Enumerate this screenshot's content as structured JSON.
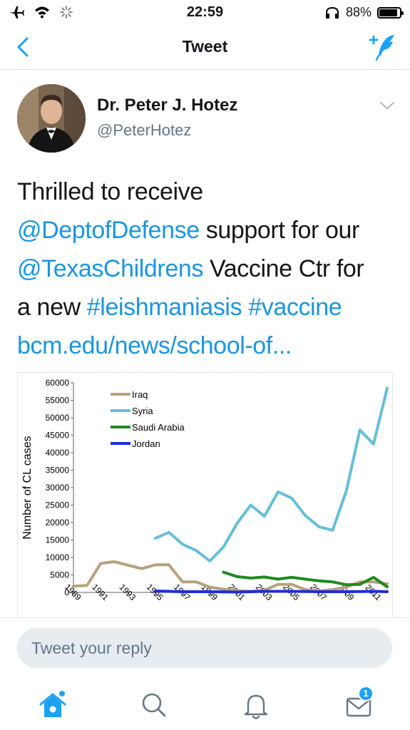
{
  "status_bar": {
    "time": "22:59",
    "battery_percent": "88%",
    "battery_level": 0.88,
    "icons": [
      "airplane-icon",
      "wifi-icon",
      "activity-spinner-icon",
      "headphones-icon",
      "battery-icon"
    ]
  },
  "nav": {
    "title": "Tweet",
    "back_icon": "chevron-left-icon",
    "compose_icon": "compose-tweet-icon",
    "accent_color": "#1da1f2"
  },
  "tweet": {
    "author_name": "Dr. Peter J. Hotez",
    "author_handle": "@PeterHotez",
    "text": [
      [
        {
          "t": "Thrilled to receive",
          "link": false
        }
      ],
      [
        {
          "t": "@DeptofDefense",
          "link": true
        },
        {
          "t": " support for our",
          "link": false
        }
      ],
      [
        {
          "t": "@TexasChildrens",
          "link": true
        },
        {
          "t": " Vaccine Ctr for",
          "link": false
        }
      ],
      [
        {
          "t": "a new ",
          "link": false
        },
        {
          "t": "#leishmaniasis",
          "link": true
        },
        {
          "t": " ",
          "link": false
        },
        {
          "t": "#vaccine",
          "link": true
        }
      ],
      [
        {
          "t": "bcm.edu/news/school-of...",
          "link": true
        }
      ]
    ],
    "link_color": "#1b95e0"
  },
  "chart_data": {
    "type": "line",
    "title": "",
    "xlabel": "",
    "ylabel": "Number of CL cases",
    "ylim": [
      0,
      60000
    ],
    "yticks": [
      0,
      5000,
      10000,
      15000,
      20000,
      25000,
      30000,
      35000,
      40000,
      45000,
      50000,
      55000,
      60000
    ],
    "xlim": [
      1989,
      2012
    ],
    "xtick_labels": [
      "1989",
      "1991",
      "1993",
      "1995",
      "1997",
      "1999",
      "2001",
      "2003",
      "2005",
      "2007",
      "2009",
      "2011"
    ],
    "grid": false,
    "legend_position": "top-left",
    "series": [
      {
        "name": "Iraq",
        "color": "#b5a27d",
        "x": [
          1989,
          1990,
          1991,
          1992,
          1993,
          1994,
          1995,
          1996,
          1997,
          1998,
          1999,
          2000,
          2001,
          2002,
          2003,
          2004,
          2005,
          2006,
          2007,
          2008,
          2009,
          2010,
          2011,
          2012
        ],
        "values": [
          1800,
          2000,
          8300,
          8800,
          7800,
          6800,
          7900,
          7900,
          3000,
          3000,
          1500,
          900,
          500,
          300,
          600,
          2300,
          2300,
          800,
          400,
          800,
          1500,
          3000,
          3000,
          2500
        ]
      },
      {
        "name": "Syria",
        "color": "#67bed8",
        "x": [
          1995,
          1996,
          1997,
          1998,
          1999,
          2000,
          2001,
          2002,
          2003,
          2004,
          2005,
          2006,
          2007,
          2008,
          2009,
          2010,
          2011,
          2012
        ],
        "values": [
          15500,
          17200,
          13800,
          12000,
          9000,
          13000,
          19800,
          25000,
          21800,
          28800,
          27000,
          22000,
          18800,
          17800,
          29000,
          46500,
          42500,
          58500
        ]
      },
      {
        "name": "Saudi Arabia",
        "color": "#1e8a1e",
        "x": [
          2000,
          2001,
          2002,
          2003,
          2004,
          2005,
          2006,
          2007,
          2008,
          2009,
          2010,
          2011,
          2012
        ],
        "values": [
          5800,
          4500,
          4100,
          4400,
          3800,
          4300,
          3800,
          3300,
          3000,
          2200,
          2300,
          4300,
          1600
        ]
      },
      {
        "name": "Jordan",
        "color": "#1a2fd9",
        "x": [
          1995,
          1997,
          1999,
          2001,
          2003,
          2005,
          2007,
          2009,
          2011,
          2012
        ],
        "values": [
          400,
          200,
          200,
          100,
          300,
          300,
          200,
          200,
          300,
          200
        ]
      }
    ]
  },
  "reply": {
    "placeholder": "Tweet your reply"
  },
  "tab_bar": {
    "items": [
      "home-icon",
      "search-icon",
      "notifications-icon",
      "messages-icon"
    ],
    "messages_badge": "1"
  }
}
